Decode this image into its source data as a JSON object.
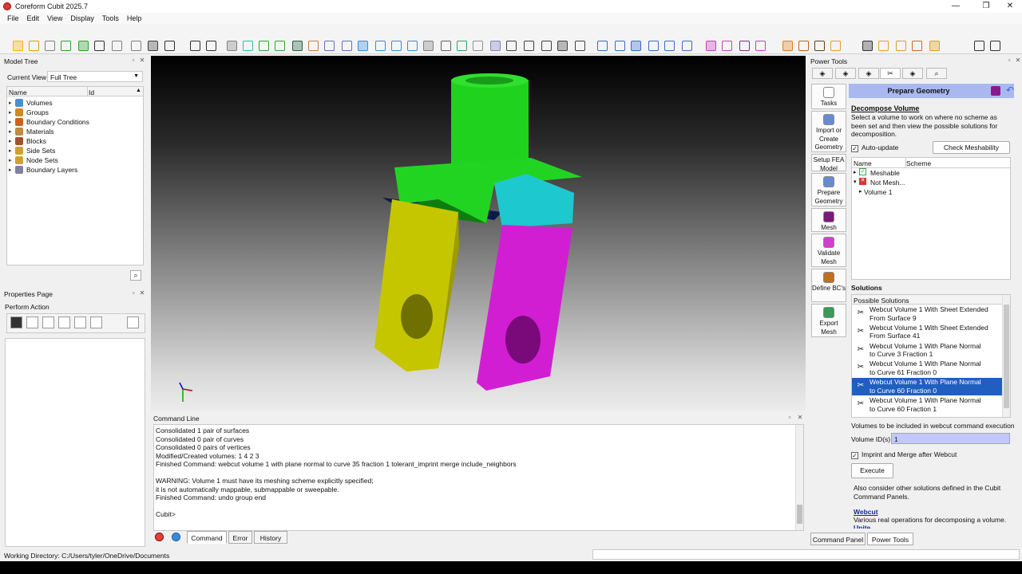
{
  "window": {
    "title": "Coreform Cubit 2025.7"
  },
  "menu": [
    "File",
    "Edit",
    "View",
    "Display",
    "Tools",
    "Help"
  ],
  "model_tree": {
    "title": "Model Tree",
    "current_view_label": "Current View",
    "current_view_value": "Full Tree",
    "col_name": "Name",
    "col_id": "Id",
    "items": [
      "Volumes",
      "Groups",
      "Boundary Conditions",
      "Materials",
      "Blocks",
      "Side Sets",
      "Node Sets",
      "Boundary Layers"
    ]
  },
  "properties": {
    "title": "Properties Page",
    "perform_action": "Perform Action"
  },
  "command_line": {
    "title": "Command Line",
    "lines": [
      "Consolidated 1 pair of surfaces",
      "Consolidated 0 pair of curves",
      "Consolidated 0 pairs of vertices",
      "Modified/Created volumes: 1 4 2 3",
      "Finished Command: webcut volume 1 with plane normal to curve 35 fraction 1 tolerant_imprint merge include_neighbors",
      "",
      "WARNING: Volume 1 must have its meshing scheme explicitly specified;",
      "it is not automatically mappable, submappable or sweepable.",
      "Finished Command: undo group end",
      "",
      "Cubit>"
    ],
    "tabs": [
      "Command",
      "Error",
      "History"
    ]
  },
  "status": {
    "working_directory": "Working Directory: C:/Users/tyler/OneDrive/Documents"
  },
  "power_tools": {
    "title": "Power Tools",
    "header": "Prepare Geometry",
    "side_buttons": [
      "Tasks",
      "Import or Create Geometry",
      "Setup FEA Model",
      "Prepare Geometry",
      "Mesh",
      "Validate Mesh",
      "Define BC's",
      "Export Mesh"
    ],
    "section_title": "Decompose Volume",
    "description": "Select a volume to work on where no scheme as been set and then view the possible solutions for decomposition.",
    "auto_update": "Auto-update",
    "check_meshability": "Check Meshability",
    "col_name": "Name",
    "col_scheme": "Scheme",
    "tree": [
      "Meshable",
      "Not Mesh...",
      "Volume 1"
    ],
    "solutions_title": "Solutions",
    "possible_solutions": "Possible Solutions",
    "solutions": [
      [
        "Webcut Volume 1 With Sheet Extended",
        "From Surface 9"
      ],
      [
        "Webcut Volume 1 With Sheet Extended",
        "From Surface 41"
      ],
      [
        "Webcut Volume 1 With Plane Normal",
        "to Curve 3 Fraction 1"
      ],
      [
        "Webcut Volume 1 With Plane Normal",
        "to Curve 61 Fraction 0"
      ],
      [
        "Webcut Volume 1 With Plane Normal",
        "to Curve 60 Fraction 0"
      ],
      [
        "Webcut Volume 1 With Plane Normal",
        "to Curve 60 Fraction 1"
      ]
    ],
    "volumes_label": "Volumes to be included in webcut command execution",
    "volume_ids_label": "Volume ID(s)",
    "volume_ids_value": "1",
    "imprint_merge": "Imprint and Merge after Webcut",
    "execute": "Execute",
    "also_consider": "Also consider other solutions defined in the Cubit Command Panels.",
    "webcut_link": "Webcut",
    "webcut_desc": "Various real operations for decomposing a volume.",
    "unite_link": "Unite",
    "bottom_tabs": [
      "Command Panel",
      "Power Tools"
    ]
  },
  "colors": {
    "accent": "#1f5fbf",
    "header": "#a9b9f0",
    "green": "#1ed21e",
    "cyan": "#1ec8cf",
    "yellow": "#c6c600",
    "magenta": "#d21ed2"
  }
}
